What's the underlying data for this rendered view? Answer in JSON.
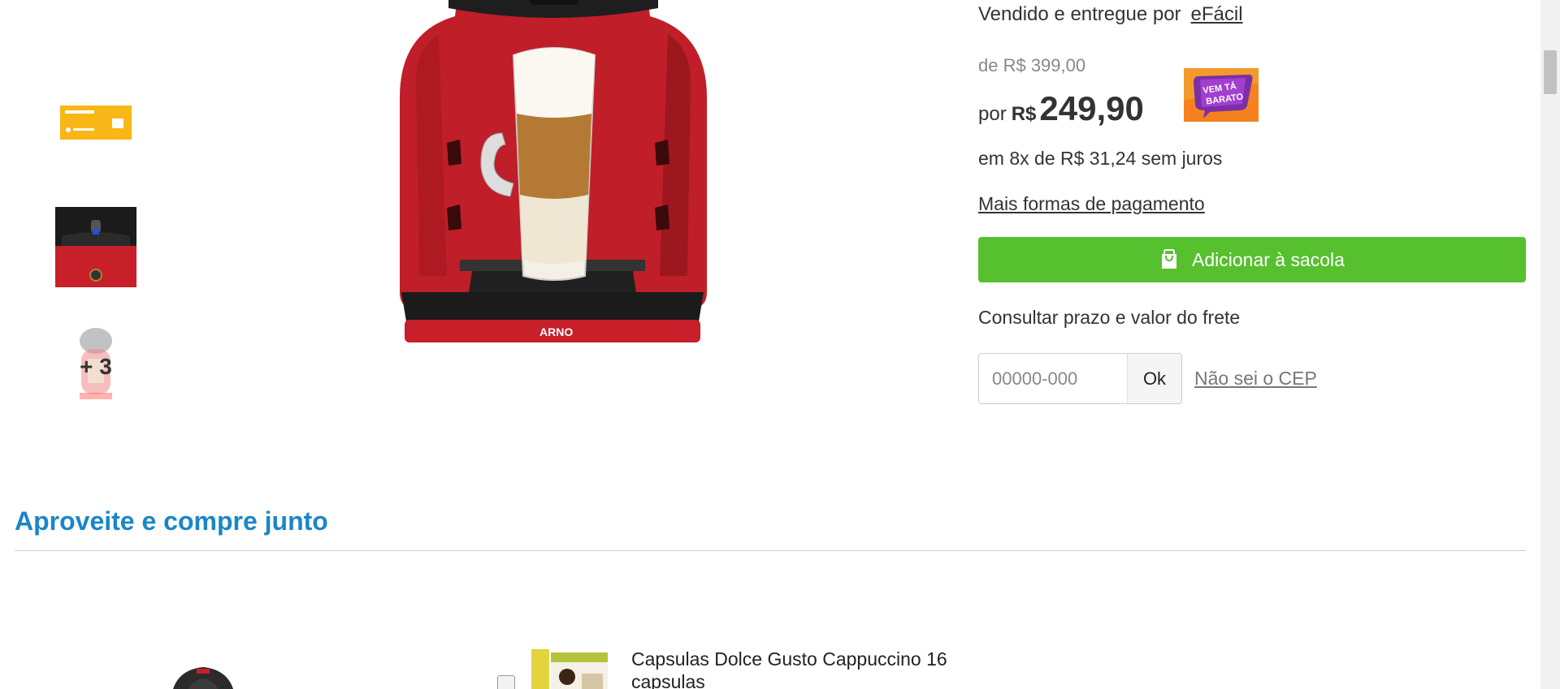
{
  "gallery": {
    "more_count_label": "+ 3",
    "main_brand_text": "ARNO"
  },
  "buybox": {
    "sold_by_text": "Vendido e entregue por",
    "seller_name": "eFácil",
    "old_price": "de R$ 399,00",
    "price_prefix": "por",
    "price_currency": "R$",
    "price_value": "249,90",
    "badge_text": "VEM TÁ BARATO",
    "installments": "em 8x de R$ 31,24 sem juros",
    "more_payment_link": "Mais formas de pagamento",
    "add_to_bag": "Adicionar à sacola",
    "freight_label": "Consultar prazo e valor do frete",
    "cep_placeholder": "00000-000",
    "cep_ok": "Ok",
    "cep_help": "Não sei o CEP"
  },
  "buy_together": {
    "title": "Aproveite e compre junto",
    "item_name": "Capsulas Dolce Gusto Cappuccino 16 capsulas"
  },
  "colors": {
    "accent_green": "#56c02e",
    "section_blue": "#1a86c8",
    "machine_red": "#c8202a"
  }
}
